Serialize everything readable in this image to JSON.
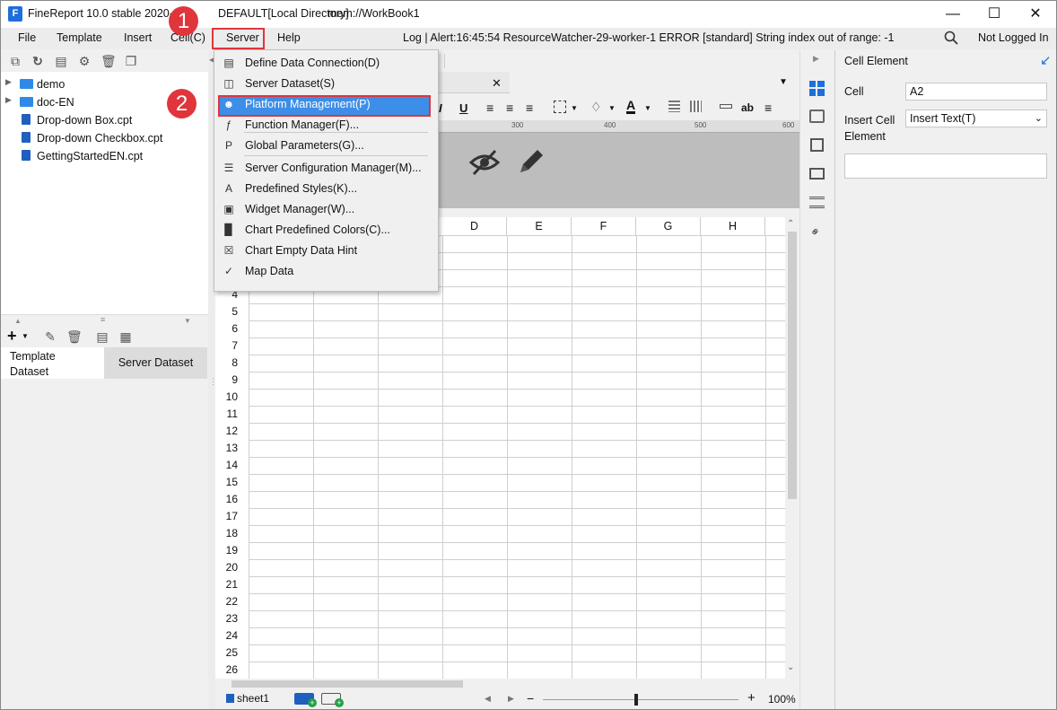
{
  "window": {
    "title": "FineReport 10.0 stable 2020-01",
    "directory": "DEFAULT[Local Directory]",
    "workbook": "mem://WorkBook1",
    "minimize_icon": "minimize-icon",
    "maximize_icon": "maximize-icon",
    "close_icon": "close-icon"
  },
  "menubar": {
    "items": [
      "File",
      "Template",
      "Insert",
      "Cell(C)",
      "Server",
      "Help"
    ],
    "log_alert": "Log | Alert:16:45:54 ResourceWatcher-29-worker-1 ERROR [standard] String index out of range: -1",
    "login_status": "Not Logged In"
  },
  "file_tree": {
    "items": [
      {
        "label": "demo",
        "type": "folder"
      },
      {
        "label": "doc-EN",
        "type": "folder"
      },
      {
        "label": "Drop-down Box.cpt",
        "type": "file"
      },
      {
        "label": "Drop-down Checkbox.cpt",
        "type": "file"
      },
      {
        "label": "GettingStartedEN.cpt",
        "type": "file"
      }
    ]
  },
  "dataset_tabs": {
    "template": "Template Dataset",
    "server": "Server Dataset"
  },
  "server_menu": {
    "items": [
      {
        "label": "Define Data Connection(D)",
        "icon": "data-connection-icon"
      },
      {
        "label": "Server Dataset(S)",
        "icon": "server-dataset-icon"
      },
      {
        "label": "Platform Management(P)",
        "icon": "platform-user-icon",
        "highlighted": true
      },
      {
        "label": "Function Manager(F)...",
        "icon": "function-icon"
      },
      {
        "label": "Global Parameters(G)...",
        "icon": "parameter-p-icon"
      },
      {
        "label": "Server Configuration Manager(M)...",
        "icon": "config-icon"
      },
      {
        "label": "Predefined Styles(K)...",
        "icon": "style-aa-icon"
      },
      {
        "label": "Widget Manager(W)...",
        "icon": "widget-icon"
      },
      {
        "label": "Chart Predefined Colors(C)...",
        "icon": "bar-chart-icon"
      },
      {
        "label": "Chart Empty Data Hint",
        "icon": "empty-chart-icon"
      },
      {
        "label": "Map Data",
        "icon": "map-icon"
      }
    ]
  },
  "ruler": {
    "marks": [
      "300",
      "400",
      "500",
      "600"
    ]
  },
  "sheet": {
    "visible_columns": [
      "D",
      "E",
      "F",
      "G",
      "H"
    ],
    "visible_rows": [
      "4",
      "5",
      "6",
      "7",
      "8",
      "9",
      "10",
      "11",
      "12",
      "13",
      "14",
      "15",
      "16",
      "17",
      "18",
      "19",
      "20",
      "21",
      "22",
      "23",
      "24",
      "25",
      "26"
    ],
    "tab_name": "sheet1",
    "zoom": "100%",
    "zoom_minus": "−",
    "zoom_plus": "+"
  },
  "cell_element_panel": {
    "title": "Cell Element",
    "cell_label": "Cell",
    "cell_value": "A2",
    "insert_label": "Insert Cell Element",
    "insert_value": "Insert Text(T)"
  },
  "annotations": {
    "step1": "1",
    "step2": "2",
    "color": "#e0353a"
  },
  "colors": {
    "highlight": "#3d8ee8",
    "accent_red": "#e0353a",
    "folder_blue": "#2e8ae6"
  }
}
